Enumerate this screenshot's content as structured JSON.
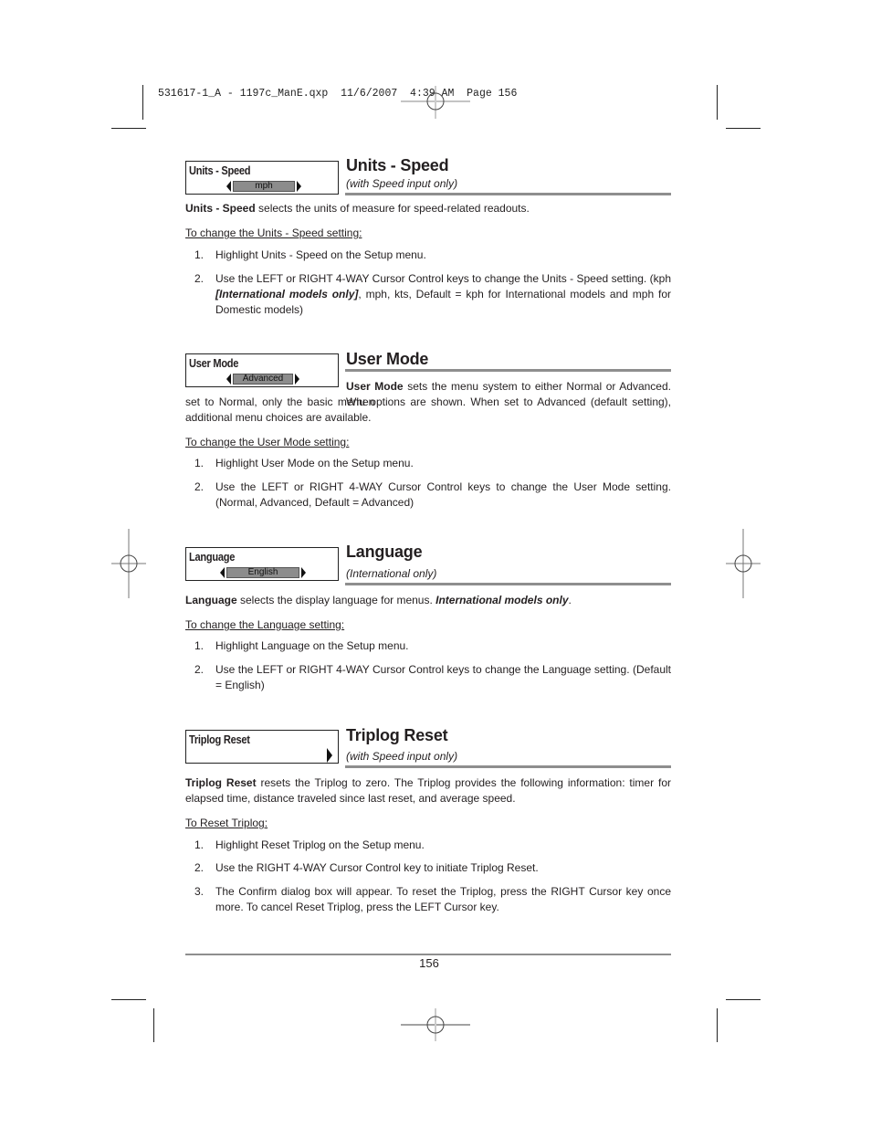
{
  "slug": "531617-1_A - 1197c_ManE.qxp  11/6/2007  4:39 AM  Page 156",
  "sections": [
    {
      "menu": {
        "label": "Units - Speed",
        "value": "mph"
      },
      "title": "Units - Speed",
      "subtitle": "(with Speed input only)",
      "desc_bold": "Units - Speed",
      "desc_rest": " selects the units of measure for speed-related readouts.",
      "howto": "To change the Units - Speed setting:",
      "steps": [
        {
          "num": "1.",
          "text": "Highlight Units - Speed on the Setup menu."
        },
        {
          "num": "2.",
          "pre": "Use the LEFT or RIGHT 4-WAY Cursor Control keys to change the Units - Speed setting. (kph ",
          "em": "[International models only]",
          "post": ", mph, kts, Default = kph for International models and mph for Domestic models)"
        }
      ]
    },
    {
      "menu": {
        "label": "User Mode",
        "value": "Advanced"
      },
      "title": "User Mode",
      "desc_bold": "User Mode",
      "desc_rest": " sets the menu system to either Normal or Advanced. When",
      "desc_cont": "set to Normal, only the basic menu options are shown. When set to Advanced (default setting), additional menu choices are available.",
      "howto": "To change the User Mode setting:",
      "steps": [
        {
          "num": "1.",
          "text": "Highlight User Mode on the Setup menu."
        },
        {
          "num": "2.",
          "text": "Use the LEFT or RIGHT 4-WAY Cursor Control keys to change the User Mode setting. (Normal, Advanced, Default = Advanced)"
        }
      ]
    },
    {
      "menu": {
        "label": "Language",
        "value": "English"
      },
      "title": "Language",
      "subtitle": "(International only)",
      "desc_bold": "Language",
      "desc_rest": " selects the display language for menus. ",
      "desc_em": "International models only",
      "desc_end": ".",
      "howto": "To change the Language setting:",
      "steps": [
        {
          "num": "1.",
          "text": "Highlight Language on the Setup menu."
        },
        {
          "num": "2.",
          "text": "Use the LEFT or RIGHT 4-WAY Cursor Control keys to change the Language setting. (Default = English)"
        }
      ]
    },
    {
      "menu": {
        "label": "Triplog Reset"
      },
      "title": "Triplog Reset",
      "subtitle": "(with Speed input only)",
      "desc_bold": "Triplog Reset",
      "desc_rest": " resets the Triplog to zero. The Triplog provides the following information: timer for elapsed time, distance traveled since last reset, and average speed.",
      "howto": "To Reset Triplog:",
      "steps": [
        {
          "num": "1.",
          "text": "Highlight Reset Triplog on the Setup menu."
        },
        {
          "num": "2.",
          "text": "Use the RIGHT 4-WAY Cursor Control key to initiate Triplog Reset."
        },
        {
          "num": "3.",
          "text": "The Confirm dialog box will appear. To reset the Triplog, press the RIGHT Cursor key once more. To cancel Reset Triplog, press the LEFT Cursor key."
        }
      ]
    }
  ],
  "page_number": "156",
  "icons": {
    "registration_mark": "crosshair-circle-icon",
    "left_arrow": "triangle-left-icon",
    "right_arrow": "triangle-right-icon"
  }
}
